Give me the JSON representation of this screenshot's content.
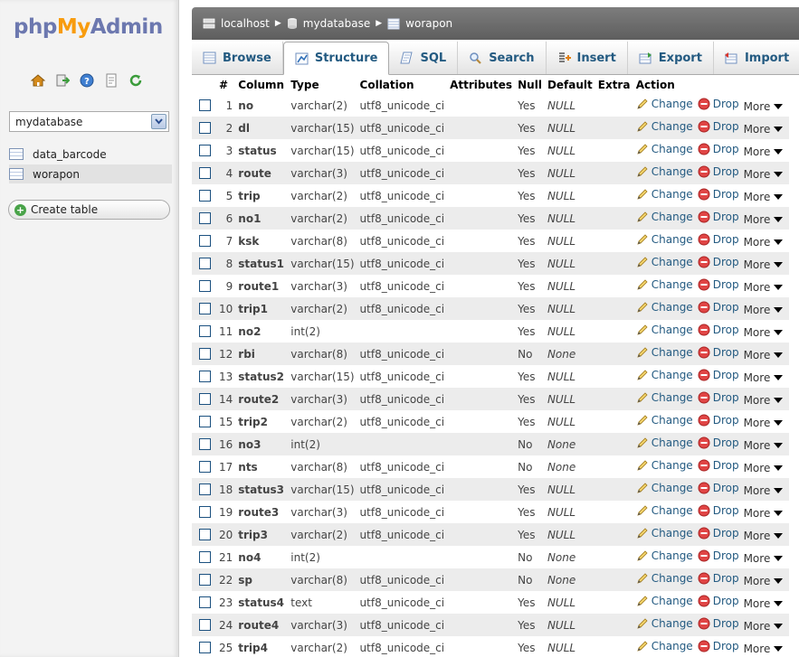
{
  "sidebar": {
    "logo": {
      "php": "php",
      "my": "My",
      "admin": "Admin"
    },
    "quick_icons": [
      "home-icon",
      "exit-icon",
      "help-icon",
      "docs-icon",
      "reload-icon"
    ],
    "db_select": "mydatabase",
    "tables": [
      {
        "label": "data_barcode",
        "active": false
      },
      {
        "label": "worapon",
        "active": true
      }
    ],
    "create_table": "Create table"
  },
  "breadcrumb": {
    "server": "localhost",
    "database": "mydatabase",
    "table": "worapon"
  },
  "tabs": [
    {
      "label": "Browse",
      "icon": "browse-icon",
      "active": false
    },
    {
      "label": "Structure",
      "icon": "structure-icon",
      "active": true
    },
    {
      "label": "SQL",
      "icon": "sql-icon",
      "active": false
    },
    {
      "label": "Search",
      "icon": "search-icon",
      "active": false
    },
    {
      "label": "Insert",
      "icon": "insert-icon",
      "active": false
    },
    {
      "label": "Export",
      "icon": "export-icon",
      "active": false
    },
    {
      "label": "Import",
      "icon": "import-icon",
      "active": false
    }
  ],
  "table": {
    "headers": [
      "#",
      "Column",
      "Type",
      "Collation",
      "Attributes",
      "Null",
      "Default",
      "Extra",
      "Action"
    ],
    "action_labels": {
      "change": "Change",
      "drop": "Drop",
      "more": "More"
    },
    "rows": [
      {
        "n": "1",
        "col": "no",
        "type": "varchar(2)",
        "coll": "utf8_unicode_ci",
        "attr": "",
        "null": "Yes",
        "def": "NULL",
        "extra": ""
      },
      {
        "n": "2",
        "col": "dl",
        "type": "varchar(15)",
        "coll": "utf8_unicode_ci",
        "attr": "",
        "null": "Yes",
        "def": "NULL",
        "extra": ""
      },
      {
        "n": "3",
        "col": "status",
        "type": "varchar(15)",
        "coll": "utf8_unicode_ci",
        "attr": "",
        "null": "Yes",
        "def": "NULL",
        "extra": ""
      },
      {
        "n": "4",
        "col": "route",
        "type": "varchar(3)",
        "coll": "utf8_unicode_ci",
        "attr": "",
        "null": "Yes",
        "def": "NULL",
        "extra": ""
      },
      {
        "n": "5",
        "col": "trip",
        "type": "varchar(2)",
        "coll": "utf8_unicode_ci",
        "attr": "",
        "null": "Yes",
        "def": "NULL",
        "extra": ""
      },
      {
        "n": "6",
        "col": "no1",
        "type": "varchar(2)",
        "coll": "utf8_unicode_ci",
        "attr": "",
        "null": "Yes",
        "def": "NULL",
        "extra": ""
      },
      {
        "n": "7",
        "col": "ksk",
        "type": "varchar(8)",
        "coll": "utf8_unicode_ci",
        "attr": "",
        "null": "Yes",
        "def": "NULL",
        "extra": ""
      },
      {
        "n": "8",
        "col": "status1",
        "type": "varchar(15)",
        "coll": "utf8_unicode_ci",
        "attr": "",
        "null": "Yes",
        "def": "NULL",
        "extra": ""
      },
      {
        "n": "9",
        "col": "route1",
        "type": "varchar(3)",
        "coll": "utf8_unicode_ci",
        "attr": "",
        "null": "Yes",
        "def": "NULL",
        "extra": ""
      },
      {
        "n": "10",
        "col": "trip1",
        "type": "varchar(2)",
        "coll": "utf8_unicode_ci",
        "attr": "",
        "null": "Yes",
        "def": "NULL",
        "extra": ""
      },
      {
        "n": "11",
        "col": "no2",
        "type": "int(2)",
        "coll": "",
        "attr": "",
        "null": "Yes",
        "def": "NULL",
        "extra": ""
      },
      {
        "n": "12",
        "col": "rbi",
        "type": "varchar(8)",
        "coll": "utf8_unicode_ci",
        "attr": "",
        "null": "No",
        "def": "None",
        "extra": ""
      },
      {
        "n": "13",
        "col": "status2",
        "type": "varchar(15)",
        "coll": "utf8_unicode_ci",
        "attr": "",
        "null": "Yes",
        "def": "NULL",
        "extra": ""
      },
      {
        "n": "14",
        "col": "route2",
        "type": "varchar(3)",
        "coll": "utf8_unicode_ci",
        "attr": "",
        "null": "Yes",
        "def": "NULL",
        "extra": ""
      },
      {
        "n": "15",
        "col": "trip2",
        "type": "varchar(2)",
        "coll": "utf8_unicode_ci",
        "attr": "",
        "null": "Yes",
        "def": "NULL",
        "extra": ""
      },
      {
        "n": "16",
        "col": "no3",
        "type": "int(2)",
        "coll": "",
        "attr": "",
        "null": "No",
        "def": "None",
        "extra": ""
      },
      {
        "n": "17",
        "col": "nts",
        "type": "varchar(8)",
        "coll": "utf8_unicode_ci",
        "attr": "",
        "null": "No",
        "def": "None",
        "extra": ""
      },
      {
        "n": "18",
        "col": "status3",
        "type": "varchar(15)",
        "coll": "utf8_unicode_ci",
        "attr": "",
        "null": "Yes",
        "def": "NULL",
        "extra": ""
      },
      {
        "n": "19",
        "col": "route3",
        "type": "varchar(3)",
        "coll": "utf8_unicode_ci",
        "attr": "",
        "null": "Yes",
        "def": "NULL",
        "extra": ""
      },
      {
        "n": "20",
        "col": "trip3",
        "type": "varchar(2)",
        "coll": "utf8_unicode_ci",
        "attr": "",
        "null": "Yes",
        "def": "NULL",
        "extra": ""
      },
      {
        "n": "21",
        "col": "no4",
        "type": "int(2)",
        "coll": "",
        "attr": "",
        "null": "No",
        "def": "None",
        "extra": ""
      },
      {
        "n": "22",
        "col": "sp",
        "type": "varchar(8)",
        "coll": "utf8_unicode_ci",
        "attr": "",
        "null": "No",
        "def": "None",
        "extra": ""
      },
      {
        "n": "23",
        "col": "status4",
        "type": "text",
        "coll": "utf8_unicode_ci",
        "attr": "",
        "null": "Yes",
        "def": "NULL",
        "extra": ""
      },
      {
        "n": "24",
        "col": "route4",
        "type": "varchar(3)",
        "coll": "utf8_unicode_ci",
        "attr": "",
        "null": "Yes",
        "def": "NULL",
        "extra": ""
      },
      {
        "n": "25",
        "col": "trip4",
        "type": "varchar(2)",
        "coll": "utf8_unicode_ci",
        "attr": "",
        "null": "Yes",
        "def": "NULL",
        "extra": ""
      }
    ]
  },
  "colors": {
    "link": "#235a81",
    "logo_blue": "#6c78af",
    "logo_orange": "#f89c0e",
    "row_alt": "#ececec",
    "breadcrumb_bg": "#6e6e6e"
  }
}
